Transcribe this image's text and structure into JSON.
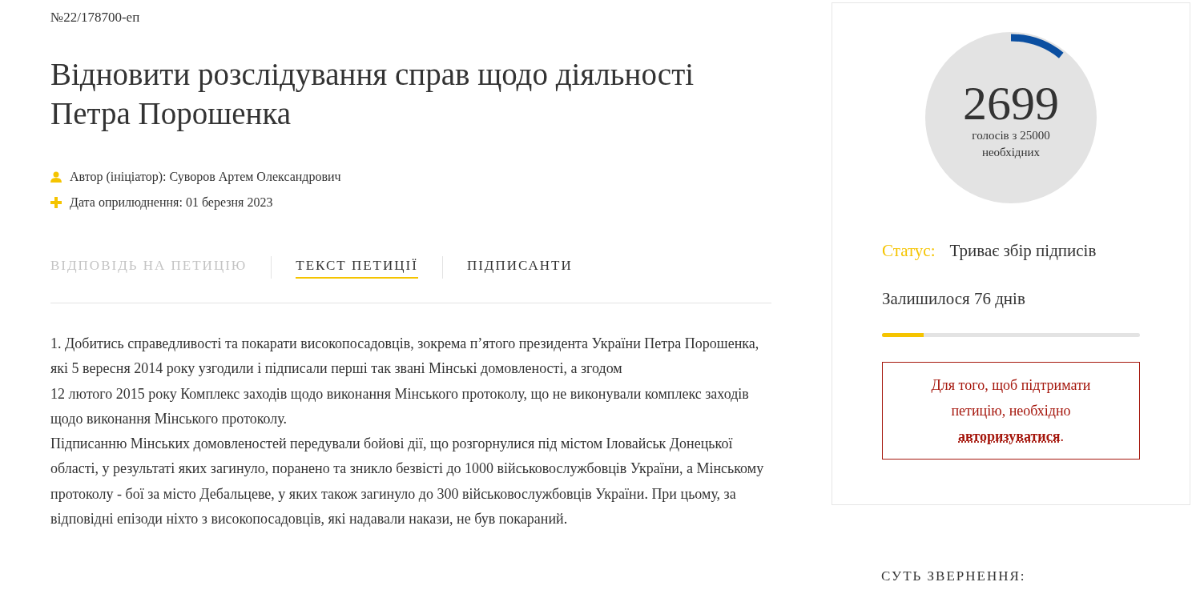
{
  "petition_number": "№22/178700-еп",
  "title": "Відновити розслідування справ щодо діяльності Петра Порошенка",
  "meta": [
    {
      "kind": "author",
      "text": "Автор (ініціатор): Суворов Артем Олександрович"
    },
    {
      "kind": "date",
      "text": "Дата оприлюднення: 01 березня 2023"
    }
  ],
  "tabs": [
    {
      "label": "ВІДПОВІДЬ НА ПЕТИЦІЮ",
      "selected": false,
      "disabled": true
    },
    {
      "label": "ТЕКСТ ПЕТИЦІЇ",
      "selected": true,
      "disabled": false
    },
    {
      "label": "ПІДПИСАНТИ",
      "selected": false,
      "disabled": false
    }
  ],
  "petition_text": [
    "1. Добитись справедливості та покарати високопосадовців, зокрема п’ятого президента України Петра Порошенка, які 5 вересня 2014 року узгодили і підписали перші так звані Мінські домовленості, а згодом",
    "12 лютого 2015 року Комплекс заходів щодо виконання Мінського протоколу, що не виконували комплекс заходів щодо виконання Мінського протоколу.",
    "Підписанню Мінських домовленостей передували бойові дії, що розгорнулися під містом Іловайськ Донецької області, у результаті яких загинуло, поранено та зникло безвісті до 1000 військовослужбовців України, а Мінському протоколу - бої за місто Дебальцеве, у яких також загинуло до 300 військовослужбовців України. При цьому, за відповідні епізоди ніхто з високопосадовців, які надавали накази, не був покараний."
  ],
  "votes": {
    "count": "2699",
    "caption": "голосів з 25000 необхідних"
  },
  "status": {
    "label": "Статус:",
    "value": "Триває збір підписів"
  },
  "remaining": {
    "text": "Залишилося 76 днів",
    "level": 0.16
  },
  "notice": {
    "text": "Для того, щоб підтримати петицію, необхідно",
    "link": "авторизуватися",
    "after": "."
  },
  "essence_heading": "СУТЬ ЗВЕРНЕННЯ:"
}
